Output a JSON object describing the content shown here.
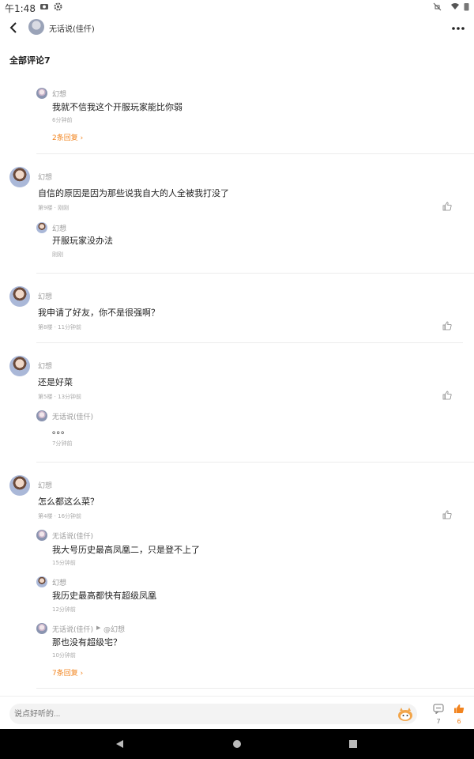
{
  "status_bar": {
    "time": "午1:48"
  },
  "header": {
    "title": "无话说(佳仟)"
  },
  "section": {
    "title": "全部评论7"
  },
  "thread1": {
    "reply": {
      "name": "幻想",
      "text": "我就不信我这个开服玩家能比你弱",
      "time": "6分钟前"
    },
    "more_replies": "2条回复"
  },
  "comment2": {
    "name": "幻想",
    "text": "自信的原因是因为那些说我自大的人全被我打没了",
    "meta": "第9楼 · 刚刚",
    "reply": {
      "name": "幻想",
      "text": "开服玩家没办法",
      "time": "刚刚"
    }
  },
  "comment3": {
    "name": "幻想",
    "text": "我申请了好友，你不是很强啊？",
    "meta": "第8楼 · 11分钟前"
  },
  "comment4": {
    "name": "幻想",
    "text": "还是好菜",
    "meta": "第5楼 · 13分钟前",
    "reply": {
      "name": "无话说(佳仟)",
      "text": "。。。",
      "time": "7分钟前"
    }
  },
  "comment5": {
    "name": "幻想",
    "text": "怎么都这么菜？",
    "meta": "第4楼 · 16分钟前",
    "replies": [
      {
        "name": "无话说(佳仟)",
        "text": "我大号历史最高凤凰二，只是登不上了",
        "time": "15分钟前"
      },
      {
        "name": "幻想",
        "text": "我历史最高都快有超级凤凰",
        "time": "12分钟前"
      },
      {
        "name": "无话说(佳仟)",
        "to": "@幻想",
        "text": "那也没有超级宅？",
        "time": "10分钟前"
      }
    ],
    "more_replies": "7条回复"
  },
  "bottom": {
    "placeholder": "说点好听的...",
    "comment_count": "7",
    "like_count": "6"
  },
  "colors": {
    "accent": "#f2841f"
  },
  "icons": [
    "back-icon",
    "more-icon",
    "like-icon",
    "comment-icon",
    "thumbs-up-icon",
    "mascot-icon"
  ]
}
